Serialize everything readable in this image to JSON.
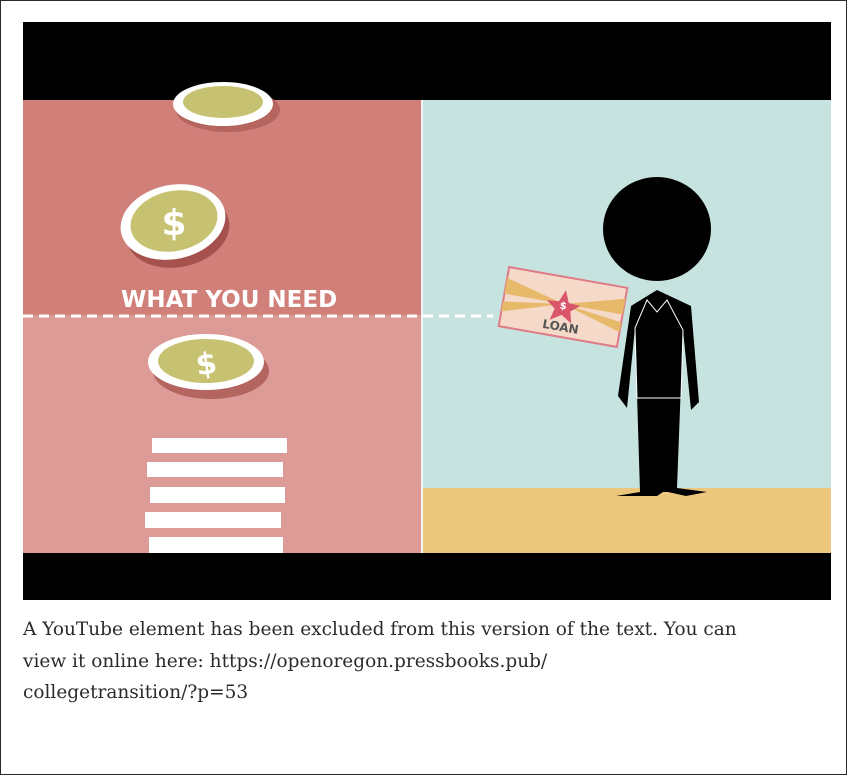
{
  "video": {
    "scene": {
      "heading": "WHAT YOU NEED",
      "coin_symbol": "$",
      "loan_label": "LOAN",
      "loan_badge_symbol": "$"
    },
    "colors": {
      "letterbox": "#000000",
      "left_top": "#d07f79",
      "left_bottom": "#dc9b97",
      "right_bg": "#c6e3df",
      "floor": "#ecc87e",
      "coin_face": "#c7c271",
      "figure": "#000000"
    }
  },
  "caption": {
    "lines": [
      "A YouTube element has been excluded from this version of the text. You can",
      "view it online here: https://openoregon.pressbooks.pub/",
      "collegetransition/?p=53"
    ]
  }
}
